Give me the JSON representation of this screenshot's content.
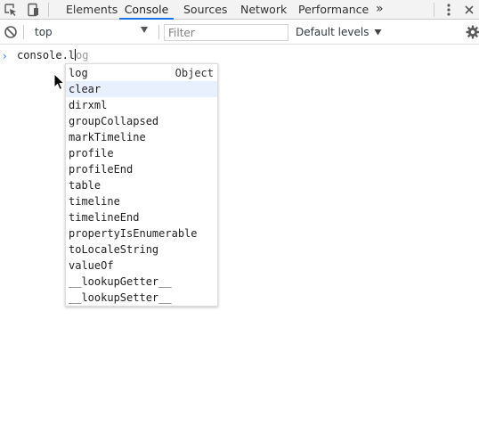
{
  "toolbar_tabs": {
    "tabs": [
      {
        "label": "Elements",
        "active": false
      },
      {
        "label": "Console",
        "active": true
      },
      {
        "label": "Sources",
        "active": false
      },
      {
        "label": "Network",
        "active": false
      },
      {
        "label": "Performance",
        "active": false
      }
    ],
    "overflow_label": "»",
    "icons": [
      "inspect-element-icon",
      "device-toolbar-icon",
      "more-menu-icon",
      "close-icon"
    ]
  },
  "filter_bar": {
    "context": "top",
    "filter_placeholder": "Filter",
    "levels_label": "Default levels",
    "icons": [
      "clear-console-icon",
      "settings-gear-icon"
    ]
  },
  "console": {
    "prompt": "›",
    "typed": "console.l",
    "ghost": "og"
  },
  "autocomplete": {
    "items": [
      "log",
      "clear",
      "dirxml",
      "groupCollapsed",
      "markTimeline",
      "profile",
      "profileEnd",
      "table",
      "timeline",
      "timelineEnd",
      "propertyIsEnumerable",
      "toLocaleString",
      "valueOf",
      "__lookupGetter__",
      "__lookupSetter__"
    ],
    "selected_index": 1,
    "type_hint": "Object"
  },
  "colors": {
    "accent": "#1a73e8",
    "selection": "#e8f0fe",
    "toolbar_bg": "#f3f3f3"
  }
}
